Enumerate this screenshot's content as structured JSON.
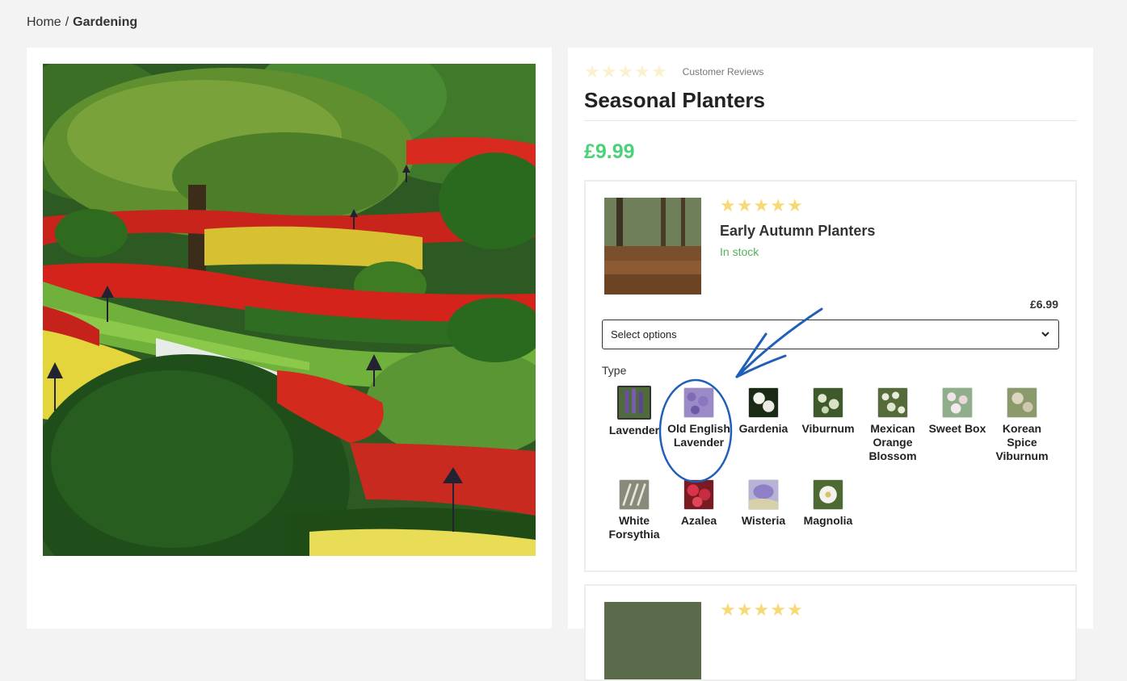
{
  "breadcrumb": {
    "home": "Home",
    "separator": "/",
    "current": "Gardening"
  },
  "product": {
    "review_label": "Customer Reviews",
    "title": "Seasonal Planters",
    "price": "£9.99",
    "rating_stars": 0
  },
  "sub_product": {
    "name": "Early Autumn Planters",
    "stock": "In stock",
    "price": "£6.99",
    "rating_stars": 5,
    "select_placeholder": "Select options",
    "type_label": "Type",
    "types": [
      {
        "label": "Lavender",
        "selected": true
      },
      {
        "label": "Old English Lavender",
        "selected": false
      },
      {
        "label": "Gardenia",
        "selected": false
      },
      {
        "label": "Viburnum",
        "selected": false
      },
      {
        "label": "Mexican Orange Blossom",
        "selected": false
      },
      {
        "label": "Sweet Box",
        "selected": false
      },
      {
        "label": "Korean Spice Viburnum",
        "selected": false
      },
      {
        "label": "White Forsythia",
        "selected": false
      },
      {
        "label": "Azalea",
        "selected": false
      },
      {
        "label": "Wisteria",
        "selected": false
      },
      {
        "label": "Magnolia",
        "selected": false
      }
    ]
  },
  "colors": {
    "price_green": "#4dd07a",
    "stock_green": "#58b05b",
    "star_gold": "#f8d977",
    "annotation_blue": "#1f5fb8"
  }
}
